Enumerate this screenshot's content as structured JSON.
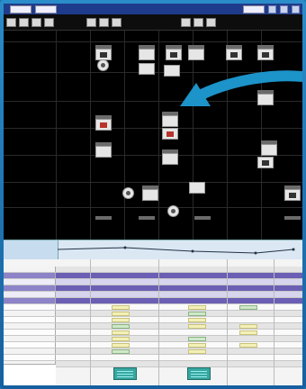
{
  "colors": {
    "frame_blue": "#1a78b0",
    "title_blue": "#1f3b8c",
    "grid_black": "#000000",
    "arrow_teal": "#1c93c9",
    "row_purple": "#6a5fb4",
    "cell_yellow": "#f3f0b8",
    "cell_green": "#cfe8c9",
    "block_teal": "#38a7a0"
  },
  "icons": [
    "close-icon",
    "minimize-icon",
    "maximize-icon",
    "arrow-pointer-icon"
  ],
  "window": {
    "title": "",
    "toolbar_buttons": 10
  },
  "timeline": {
    "markers": 6
  },
  "table": {
    "rows": 16
  }
}
